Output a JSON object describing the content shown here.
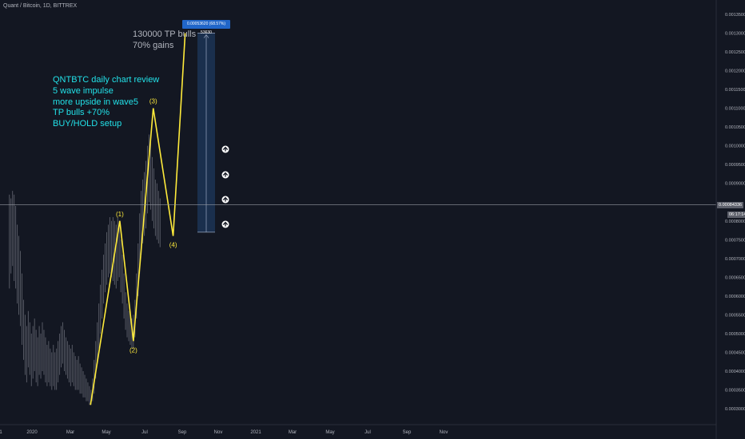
{
  "symbol": "Quant / Bitcoin, 1D, BITTREX",
  "colors": {
    "background": "#131722",
    "candle": "#5d606b",
    "wave": "#ffeb3b",
    "review_text": "#22e1e8",
    "crosshair": "#9598a1",
    "measure_fill": "#1e3a5f",
    "arrow": "#ffffff"
  },
  "annotations": {
    "review": [
      "QNTBTC daily chart review",
      "5 wave impulse",
      "more upside in wave5",
      "TP bulls +70%",
      "BUY/HOLD setup"
    ],
    "tp": [
      "130000 TP bulls",
      "70% gains"
    ],
    "measure_label": "0.00053620 (68.57%) 53630"
  },
  "price_tags": {
    "current": "0.00084336",
    "countdown": "06:17:14"
  },
  "chart_data": {
    "type": "line",
    "title": "Quant / Bitcoin, 1D, BITTREX",
    "x_ticks": [
      "1",
      "2020",
      "Mar",
      "May",
      "Jul",
      "Sep",
      "Nov",
      "2021",
      "Mar",
      "May",
      "Jul",
      "Sep",
      "Nov"
    ],
    "y_ticks": [
      "0.00135000",
      "0.00130000",
      "0.00125000",
      "0.00120000",
      "0.00115000",
      "0.00110000",
      "0.00105000",
      "0.00100000",
      "0.00095000",
      "0.00090000",
      "0.00080000",
      "0.00075000",
      "0.00070000",
      "0.00065000",
      "0.00060000",
      "0.00055000",
      "0.00050000",
      "0.00045000",
      "0.00040000",
      "0.00035000",
      "0.00030000"
    ],
    "ylim": [
      0.00027,
      0.00137
    ],
    "wave_labels": [
      "(1)",
      "(2)",
      "(3)",
      "(4)"
    ],
    "wave": [
      {
        "x": "2020-03-05",
        "y": 0.00031
      },
      {
        "x": "2020-04-30",
        "y": 0.0008
      },
      {
        "x": "2020-05-26",
        "y": 0.00048
      },
      {
        "x": "2020-07-03",
        "y": 0.0011
      },
      {
        "x": "2020-08-10",
        "y": 0.00076
      },
      {
        "x": "2020-09-02",
        "y": 0.0013
      }
    ],
    "current_price": 0.00084336,
    "measure_range": [
      0.00077,
      0.0013
    ],
    "series": [
      {
        "values": [
          {
            "x": "2019-10-02",
            "high": 0.00087,
            "low": 0.00062
          },
          {
            "x": "2019-10-05",
            "high": 0.00086,
            "low": 0.00066
          },
          {
            "x": "2019-10-08",
            "high": 0.00088,
            "low": 0.00068
          },
          {
            "x": "2019-10-11",
            "high": 0.00087,
            "low": 0.00064
          },
          {
            "x": "2019-10-14",
            "high": 0.00084,
            "low": 0.00062
          },
          {
            "x": "2019-10-17",
            "high": 0.00079,
            "low": 0.00058
          },
          {
            "x": "2019-10-20",
            "high": 0.00076,
            "low": 0.00055
          },
          {
            "x": "2019-10-23",
            "high": 0.00072,
            "low": 0.00052
          },
          {
            "x": "2019-10-26",
            "high": 0.00066,
            "low": 0.00047
          },
          {
            "x": "2019-10-29",
            "high": 0.00059,
            "low": 0.00043
          },
          {
            "x": "2019-11-01",
            "high": 0.00055,
            "low": 0.00039
          },
          {
            "x": "2019-11-04",
            "high": 0.00052,
            "low": 0.00037
          },
          {
            "x": "2019-11-07",
            "high": 0.00056,
            "low": 0.00041
          },
          {
            "x": "2019-11-10",
            "high": 0.00053,
            "low": 0.00039
          },
          {
            "x": "2019-11-13",
            "high": 0.0005,
            "low": 0.00036
          },
          {
            "x": "2019-11-16",
            "high": 0.00052,
            "low": 0.00038
          },
          {
            "x": "2019-11-19",
            "high": 0.00054,
            "low": 0.0004
          },
          {
            "x": "2019-11-22",
            "high": 0.00051,
            "low": 0.00037
          },
          {
            "x": "2019-11-25",
            "high": 0.00049,
            "low": 0.00036
          },
          {
            "x": "2019-11-28",
            "high": 0.00052,
            "low": 0.00039
          },
          {
            "x": "2019-12-01",
            "high": 0.0005,
            "low": 0.00038
          },
          {
            "x": "2019-12-04",
            "high": 0.00053,
            "low": 0.0004
          },
          {
            "x": "2019-12-07",
            "high": 0.00051,
            "low": 0.00039
          },
          {
            "x": "2019-12-10",
            "high": 0.00049,
            "low": 0.00037
          },
          {
            "x": "2019-12-13",
            "high": 0.00047,
            "low": 0.00036
          },
          {
            "x": "2019-12-16",
            "high": 0.00048,
            "low": 0.00037
          },
          {
            "x": "2019-12-19",
            "high": 0.00046,
            "low": 0.00036
          },
          {
            "x": "2019-12-22",
            "high": 0.00045,
            "low": 0.00035
          },
          {
            "x": "2019-12-25",
            "high": 0.00047,
            "low": 0.00036
          },
          {
            "x": "2019-12-28",
            "high": 0.00045,
            "low": 0.00035
          },
          {
            "x": "2019-12-31",
            "high": 0.00046,
            "low": 0.00035
          },
          {
            "x": "2020-01-03",
            "high": 0.00048,
            "low": 0.00037
          },
          {
            "x": "2020-01-06",
            "high": 0.0005,
            "low": 0.00039
          },
          {
            "x": "2020-01-09",
            "high": 0.00052,
            "low": 0.00041
          },
          {
            "x": "2020-01-12",
            "high": 0.00053,
            "low": 0.00042
          },
          {
            "x": "2020-01-15",
            "high": 0.00051,
            "low": 0.0004
          },
          {
            "x": "2020-01-18",
            "high": 0.00049,
            "low": 0.00039
          },
          {
            "x": "2020-01-21",
            "high": 0.00048,
            "low": 0.00038
          },
          {
            "x": "2020-01-24",
            "high": 0.00047,
            "low": 0.00037
          },
          {
            "x": "2020-01-27",
            "high": 0.00046,
            "low": 0.00036
          },
          {
            "x": "2020-01-30",
            "high": 0.00047,
            "low": 0.00037
          },
          {
            "x": "2020-02-02",
            "high": 0.00045,
            "low": 0.00036
          },
          {
            "x": "2020-02-05",
            "high": 0.00044,
            "low": 0.00035
          },
          {
            "x": "2020-02-08",
            "high": 0.00043,
            "low": 0.00035
          },
          {
            "x": "2020-02-11",
            "high": 0.00044,
            "low": 0.00035
          },
          {
            "x": "2020-02-14",
            "high": 0.00042,
            "low": 0.00034
          },
          {
            "x": "2020-02-17",
            "high": 0.00041,
            "low": 0.00034
          },
          {
            "x": "2020-02-20",
            "high": 0.0004,
            "low": 0.00033
          },
          {
            "x": "2020-02-23",
            "high": 0.00039,
            "low": 0.00033
          },
          {
            "x": "2020-02-26",
            "high": 0.00038,
            "low": 0.00032
          },
          {
            "x": "2020-02-29",
            "high": 0.00037,
            "low": 0.00032
          },
          {
            "x": "2020-03-03",
            "high": 0.00036,
            "low": 0.00031
          },
          {
            "x": "2020-03-06",
            "high": 0.00035,
            "low": 0.00031
          },
          {
            "x": "2020-03-09",
            "high": 0.00038,
            "low": 0.00032
          },
          {
            "x": "2020-03-12",
            "high": 0.00043,
            "low": 0.00034
          },
          {
            "x": "2020-03-15",
            "high": 0.00048,
            "low": 0.00038
          },
          {
            "x": "2020-03-18",
            "high": 0.00053,
            "low": 0.00042
          },
          {
            "x": "2020-03-21",
            "high": 0.00058,
            "low": 0.00046
          },
          {
            "x": "2020-03-24",
            "high": 0.00063,
            "low": 0.0005
          },
          {
            "x": "2020-03-27",
            "high": 0.00067,
            "low": 0.00054
          },
          {
            "x": "2020-03-30",
            "high": 0.00071,
            "low": 0.00058
          },
          {
            "x": "2020-04-02",
            "high": 0.00074,
            "low": 0.00061
          },
          {
            "x": "2020-04-05",
            "high": 0.00077,
            "low": 0.00063
          },
          {
            "x": "2020-04-08",
            "high": 0.00079,
            "low": 0.00065
          },
          {
            "x": "2020-04-11",
            "high": 0.00081,
            "low": 0.00066
          },
          {
            "x": "2020-04-14",
            "high": 0.0008,
            "low": 0.00065
          },
          {
            "x": "2020-04-17",
            "high": 0.00081,
            "low": 0.00064
          },
          {
            "x": "2020-04-20",
            "high": 0.0008,
            "low": 0.00063
          },
          {
            "x": "2020-04-23",
            "high": 0.00079,
            "low": 0.00062
          },
          {
            "x": "2020-04-26",
            "high": 0.00081,
            "low": 0.00064
          },
          {
            "x": "2020-04-29",
            "high": 0.0008,
            "low": 0.00065
          },
          {
            "x": "2020-05-02",
            "high": 0.00075,
            "low": 0.00061
          },
          {
            "x": "2020-05-05",
            "high": 0.00071,
            "low": 0.00058
          },
          {
            "x": "2020-05-08",
            "high": 0.00066,
            "low": 0.00054
          },
          {
            "x": "2020-05-11",
            "high": 0.00061,
            "low": 0.00051
          },
          {
            "x": "2020-05-14",
            "high": 0.00058,
            "low": 0.00049
          },
          {
            "x": "2020-05-17",
            "high": 0.00056,
            "low": 0.00048
          },
          {
            "x": "2020-05-20",
            "high": 0.00055,
            "low": 0.00047
          },
          {
            "x": "2020-05-23",
            "high": 0.00054,
            "low": 0.00046
          },
          {
            "x": "2020-05-26",
            "high": 0.00055,
            "low": 0.00046
          },
          {
            "x": "2020-05-29",
            "high": 0.00059,
            "low": 0.00049
          },
          {
            "x": "2020-06-01",
            "high": 0.00066,
            "low": 0.00054
          },
          {
            "x": "2020-06-04",
            "high": 0.00074,
            "low": 0.0006
          },
          {
            "x": "2020-06-07",
            "high": 0.00082,
            "low": 0.00066
          },
          {
            "x": "2020-06-10",
            "high": 0.00088,
            "low": 0.00071
          },
          {
            "x": "2020-06-13",
            "high": 0.00091,
            "low": 0.00074
          },
          {
            "x": "2020-06-16",
            "high": 0.00093,
            "low": 0.00076
          },
          {
            "x": "2020-06-19",
            "high": 0.00096,
            "low": 0.00078
          },
          {
            "x": "2020-06-22",
            "high": 0.001,
            "low": 0.00082
          },
          {
            "x": "2020-06-25",
            "high": 0.00103,
            "low": 0.00085
          },
          {
            "x": "2020-06-28",
            "high": 0.00101,
            "low": 0.00083
          },
          {
            "x": "2020-07-01",
            "high": 0.00097,
            "low": 0.0008
          },
          {
            "x": "2020-07-04",
            "high": 0.00094,
            "low": 0.00078
          },
          {
            "x": "2020-07-07",
            "high": 0.00091,
            "low": 0.00076
          },
          {
            "x": "2020-07-10",
            "high": 0.0009,
            "low": 0.00075
          },
          {
            "x": "2020-07-13",
            "high": 0.00088,
            "low": 0.00074
          },
          {
            "x": "2020-07-16",
            "high": 0.00086,
            "low": 0.00073
          }
        ]
      }
    ]
  }
}
